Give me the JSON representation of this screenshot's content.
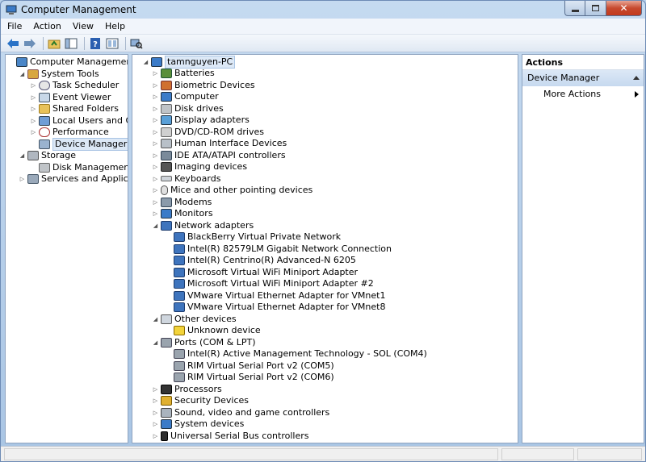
{
  "window": {
    "title": "Computer Management"
  },
  "menu": [
    "File",
    "Action",
    "View",
    "Help"
  ],
  "toolbar": {
    "icons": [
      "back-arrow-icon",
      "forward-arrow-icon",
      "up-folder-icon",
      "show-hide-tree-icon",
      "help-icon",
      "properties-icon",
      "scan-hardware-icon"
    ]
  },
  "left_tree": [
    {
      "label": "Computer Management (Local",
      "level": 0,
      "expander": "",
      "icon": "computer"
    },
    {
      "label": "System Tools",
      "level": 1,
      "expander": "open",
      "icon": "tools"
    },
    {
      "label": "Task Scheduler",
      "level": 2,
      "expander": "closed",
      "icon": "clock"
    },
    {
      "label": "Event Viewer",
      "level": 2,
      "expander": "closed",
      "icon": "event"
    },
    {
      "label": "Shared Folders",
      "level": 2,
      "expander": "closed",
      "icon": "folder"
    },
    {
      "label": "Local Users and Groups",
      "level": 2,
      "expander": "closed",
      "icon": "users"
    },
    {
      "label": "Performance",
      "level": 2,
      "expander": "closed",
      "icon": "perf"
    },
    {
      "label": "Device Manager",
      "level": 2,
      "expander": "",
      "icon": "devmgr",
      "selected": true
    },
    {
      "label": "Storage",
      "level": 1,
      "expander": "open",
      "icon": "storage"
    },
    {
      "label": "Disk Management",
      "level": 2,
      "expander": "",
      "icon": "disk"
    },
    {
      "label": "Services and Applications",
      "level": 1,
      "expander": "closed",
      "icon": "services"
    }
  ],
  "device_tree": {
    "root": "tamnguyen-PC",
    "items": [
      {
        "label": "Batteries",
        "level": 1,
        "expander": "closed",
        "icon": "battery"
      },
      {
        "label": "Biometric Devices",
        "level": 1,
        "expander": "closed",
        "icon": "biometric"
      },
      {
        "label": "Computer",
        "level": 1,
        "expander": "closed",
        "icon": "monitor"
      },
      {
        "label": "Disk drives",
        "level": 1,
        "expander": "closed",
        "icon": "disk"
      },
      {
        "label": "Display adapters",
        "level": 1,
        "expander": "closed",
        "icon": "display"
      },
      {
        "label": "DVD/CD-ROM drives",
        "level": 1,
        "expander": "closed",
        "icon": "dvd"
      },
      {
        "label": "Human Interface Devices",
        "level": 1,
        "expander": "closed",
        "icon": "hid"
      },
      {
        "label": "IDE ATA/ATAPI controllers",
        "level": 1,
        "expander": "closed",
        "icon": "ide"
      },
      {
        "label": "Imaging devices",
        "level": 1,
        "expander": "closed",
        "icon": "camera"
      },
      {
        "label": "Keyboards",
        "level": 1,
        "expander": "closed",
        "icon": "keyboard"
      },
      {
        "label": "Mice and other pointing devices",
        "level": 1,
        "expander": "closed",
        "icon": "mouse"
      },
      {
        "label": "Modems",
        "level": 1,
        "expander": "closed",
        "icon": "modem"
      },
      {
        "label": "Monitors",
        "level": 1,
        "expander": "closed",
        "icon": "monitor"
      },
      {
        "label": "Network adapters",
        "level": 1,
        "expander": "open",
        "icon": "network"
      },
      {
        "label": "BlackBerry Virtual Private Network",
        "level": 2,
        "expander": "",
        "icon": "network"
      },
      {
        "label": "Intel(R) 82579LM Gigabit Network Connection",
        "level": 2,
        "expander": "",
        "icon": "network"
      },
      {
        "label": "Intel(R) Centrino(R) Advanced-N 6205",
        "level": 2,
        "expander": "",
        "icon": "network"
      },
      {
        "label": "Microsoft Virtual WiFi Miniport Adapter",
        "level": 2,
        "expander": "",
        "icon": "network"
      },
      {
        "label": "Microsoft Virtual WiFi Miniport Adapter #2",
        "level": 2,
        "expander": "",
        "icon": "network"
      },
      {
        "label": "VMware Virtual Ethernet Adapter for VMnet1",
        "level": 2,
        "expander": "",
        "icon": "network"
      },
      {
        "label": "VMware Virtual Ethernet Adapter for VMnet8",
        "level": 2,
        "expander": "",
        "icon": "network"
      },
      {
        "label": "Other devices",
        "level": 1,
        "expander": "open",
        "icon": "other"
      },
      {
        "label": "Unknown device",
        "level": 2,
        "expander": "",
        "icon": "warning"
      },
      {
        "label": "Ports (COM & LPT)",
        "level": 1,
        "expander": "open",
        "icon": "port"
      },
      {
        "label": "Intel(R) Active Management Technology - SOL (COM4)",
        "level": 2,
        "expander": "",
        "icon": "port"
      },
      {
        "label": "RIM Virtual Serial Port v2 (COM5)",
        "level": 2,
        "expander": "",
        "icon": "port"
      },
      {
        "label": "RIM Virtual Serial Port v2 (COM6)",
        "level": 2,
        "expander": "",
        "icon": "port"
      },
      {
        "label": "Processors",
        "level": 1,
        "expander": "closed",
        "icon": "cpu"
      },
      {
        "label": "Security Devices",
        "level": 1,
        "expander": "closed",
        "icon": "security"
      },
      {
        "label": "Sound, video and game controllers",
        "level": 1,
        "expander": "closed",
        "icon": "sound"
      },
      {
        "label": "System devices",
        "level": 1,
        "expander": "closed",
        "icon": "monitor"
      },
      {
        "label": "Universal Serial Bus controllers",
        "level": 1,
        "expander": "closed",
        "icon": "usb"
      }
    ]
  },
  "actions": {
    "header": "Actions",
    "section": "Device Manager",
    "more": "More Actions"
  },
  "colors": {
    "selection": "#dce8f6",
    "pane_border": "#8fa4c0",
    "chrome": "#b9d1ea"
  }
}
